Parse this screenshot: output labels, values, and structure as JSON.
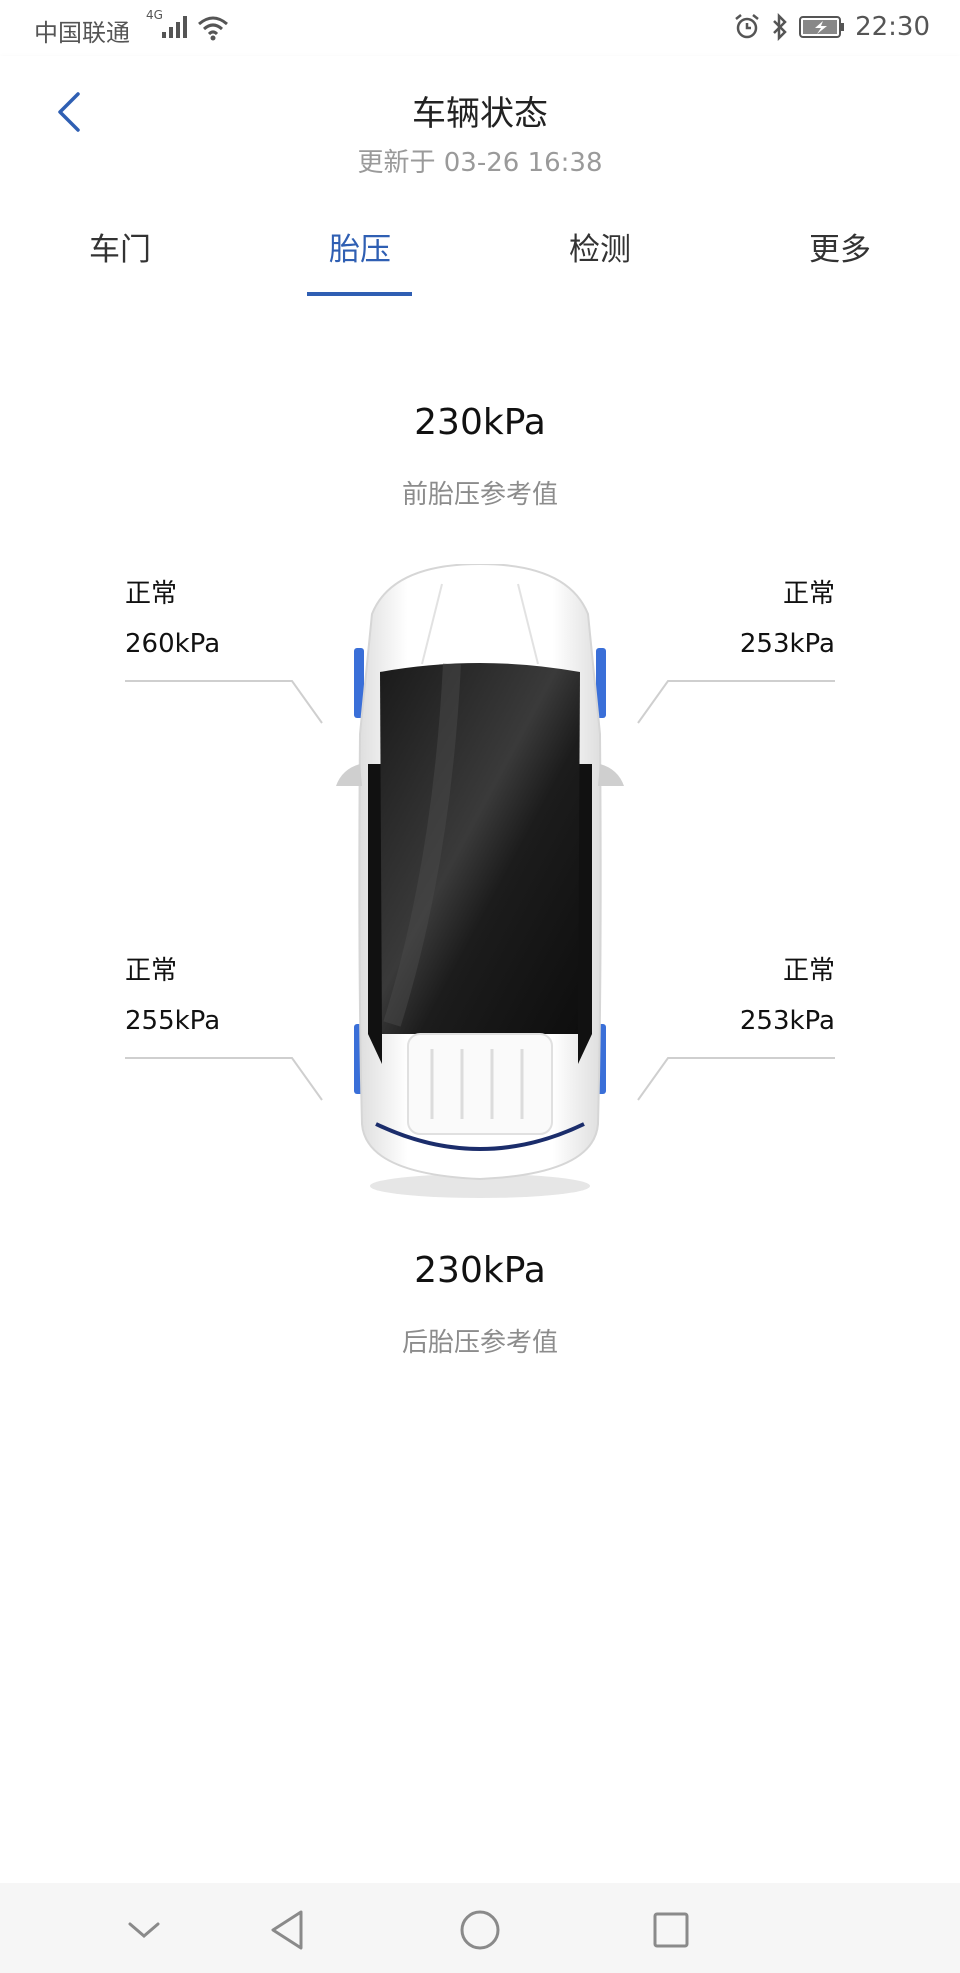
{
  "status_bar": {
    "carrier": "中国联通",
    "network": "4G",
    "time": "22:30",
    "icons": [
      "signal-icon",
      "wifi-icon",
      "alarm-icon",
      "bluetooth-icon",
      "battery-icon"
    ]
  },
  "header": {
    "title": "车辆状态",
    "updated": "更新于 03-26 16:38"
  },
  "tabs": [
    {
      "label": "车门",
      "active": false
    },
    {
      "label": "胎压",
      "active": true
    },
    {
      "label": "检测",
      "active": false
    },
    {
      "label": "更多",
      "active": false
    }
  ],
  "tire_pressure": {
    "front_reference": {
      "value": "230kPa",
      "label": "前胎压参考值"
    },
    "rear_reference": {
      "value": "230kPa",
      "label": "后胎压参考值"
    },
    "front_left": {
      "status": "正常",
      "value": "260kPa"
    },
    "front_right": {
      "status": "正常",
      "value": "253kPa"
    },
    "rear_left": {
      "status": "正常",
      "value": "255kPa"
    },
    "rear_right": {
      "status": "正常",
      "value": "253kPa"
    }
  },
  "nav_bar": {
    "icons": [
      "chevron-down-icon",
      "back-triangle-icon",
      "home-circle-icon",
      "recents-square-icon"
    ]
  },
  "colors": {
    "accent": "#2f5fb3",
    "tire_highlight": "#3a6fd8"
  }
}
